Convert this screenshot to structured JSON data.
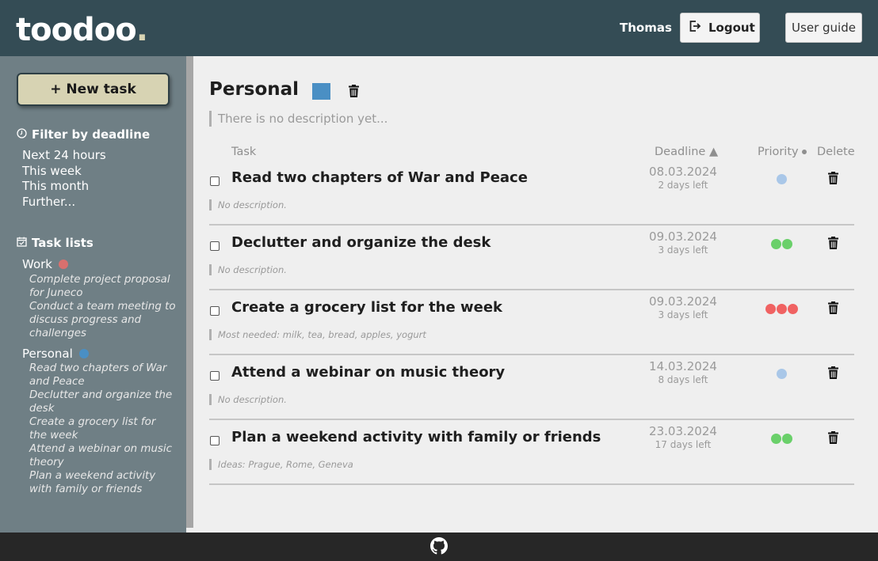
{
  "header": {
    "logo_text": "toodoo",
    "logo_dot": ".",
    "username": "Thomas",
    "logout_label": "Logout",
    "user_guide_label": "User guide",
    "logout_icon": "logout-icon"
  },
  "sidebar": {
    "new_task_label": "+ New task",
    "filter_heading": "Filter by deadline",
    "filter_icon": "clock-icon",
    "filters": [
      "Next 24 hours",
      "This week",
      "This month",
      "Further..."
    ],
    "lists_heading": "Task lists",
    "lists_icon": "calendar-check-icon",
    "lists": [
      {
        "name": "Work",
        "color": "#d9706e",
        "tasks": [
          "Complete project proposal for Juneco",
          "Conduct a team meeting to discuss progress and challenges"
        ]
      },
      {
        "name": "Personal",
        "color": "#4a8fc4",
        "tasks": [
          "Read two chapters of War and Peace",
          "Declutter and organize the desk",
          "Create a grocery list for the week",
          "Attend a webinar on music theory",
          "Plan a weekend activity with family or friends"
        ]
      }
    ]
  },
  "main": {
    "list_title": "Personal",
    "list_color": "#4a8fc4",
    "description_placeholder": "There is no description yet...",
    "columns": {
      "task": "Task",
      "deadline": "Deadline ▲",
      "priority": "Priority",
      "delete": "Delete"
    },
    "priority_colors": {
      "low": "#a9c7e8",
      "medium": "#6ad06a",
      "high": "#f06262"
    },
    "tasks": [
      {
        "title": "Read two chapters of War and Peace",
        "description": "No description.",
        "deadline": "08.03.2024",
        "days_left": "2 days left",
        "priority": 1
      },
      {
        "title": "Declutter and organize the desk",
        "description": "No description.",
        "deadline": "09.03.2024",
        "days_left": "3 days left",
        "priority": 2
      },
      {
        "title": "Create a grocery list for the week",
        "description": "Most needed: milk, tea, bread, apples, yogurt",
        "deadline": "09.03.2024",
        "days_left": "3 days left",
        "priority": 3
      },
      {
        "title": "Attend a webinar on music theory",
        "description": "No description.",
        "deadline": "14.03.2024",
        "days_left": "8 days left",
        "priority": 1
      },
      {
        "title": "Plan a weekend activity with family or friends",
        "description": "Ideas: Prague, Rome, Geneva",
        "deadline": "23.03.2024",
        "days_left": "17 days left",
        "priority": 2
      }
    ]
  },
  "footer": {
    "icon": "github-icon"
  }
}
